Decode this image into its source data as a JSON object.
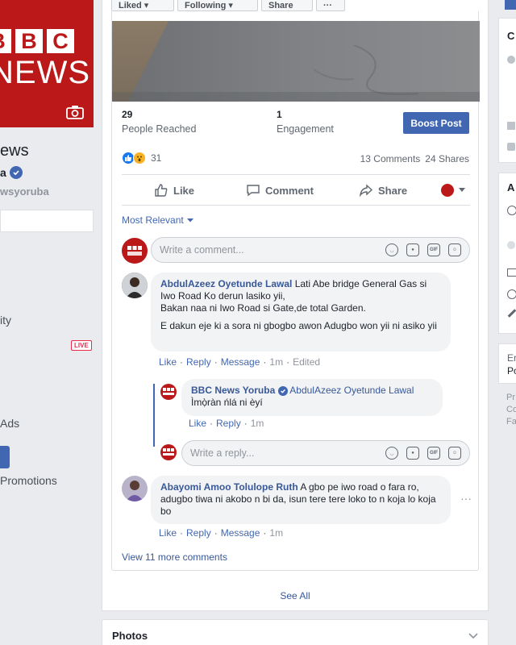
{
  "topbar": {
    "liked": "Liked ▾",
    "following": "Following ▾",
    "share": "Share",
    "more": "···"
  },
  "left": {
    "cover": {
      "brand_bbc": [
        "B",
        "B",
        "C"
      ],
      "brand_news": "NEWS"
    },
    "page_name": "ews",
    "page_name_suffix": "a",
    "handle": "wsyoruba",
    "nav": {
      "community": "ity",
      "ads": "Ads",
      "promotions": "Promotions"
    },
    "live_badge": "LIVE"
  },
  "post": {
    "stats": {
      "reached_num": "29",
      "reached_label": "People Reached",
      "engagement_num": "1",
      "engagement_label": "Engagement",
      "boost_label": "Boost Post"
    },
    "reactions_count": "31",
    "comments_count": "13 Comments",
    "shares_count": "24 Shares",
    "actions": {
      "like": "Like",
      "comment": "Comment",
      "share": "Share"
    },
    "sort_label": "Most Relevant",
    "comment_placeholder": "Write a comment...",
    "reply_placeholder": "Write a reply...",
    "comments": [
      {
        "author": "AbdulAzeez Oyetunde Lawal",
        "text1": "Lati Abe bridge General Gas si Iwo Road Ko derun lasiko yii,",
        "text2": "Bakan naa ni Iwo Road si Gate,de total Garden.",
        "text3": "E dakun eje ki a sora ni gbogbo awon Adugbo won yii ni asiko yii",
        "meta": {
          "like": "Like",
          "reply": "Reply",
          "message": "Message",
          "time": "1m",
          "edited": "Edited"
        }
      },
      {
        "author": "Abayomi Amoo Tolulope Ruth",
        "text": "A gbo pe iwo road o fara ro, adugbo tiwa ni akobo n bi da, isun tere tere loko to n koja lo koja bo",
        "meta": {
          "like": "Like",
          "reply": "Reply",
          "message": "Message",
          "time": "1m"
        }
      }
    ],
    "reply": {
      "author": "BBC News Yoruba",
      "mention": "AbdulAzeez Oyetunde Lawal",
      "text": "Ìmọ̀ràn ńlá ni èyí",
      "meta": {
        "like": "Like",
        "reply": "Reply",
        "time": "1m"
      }
    },
    "view_more": "View 11 more comments",
    "see_all": "See All",
    "comment_icons": [
      "smile-icon",
      "camera-icon",
      "gif-icon",
      "sticker-icon"
    ],
    "gif_label": "GIF"
  },
  "photos_title": "Photos",
  "right": {
    "t1": "C",
    "t2": "A",
    "t3": "Er",
    "t4": "Po",
    "t5": "Pr",
    "t6": "Co",
    "t7": "Fa"
  },
  "colors": {
    "brand_blue": "#4267b2",
    "bbc_red": "#bb1919",
    "link": "#385898"
  }
}
